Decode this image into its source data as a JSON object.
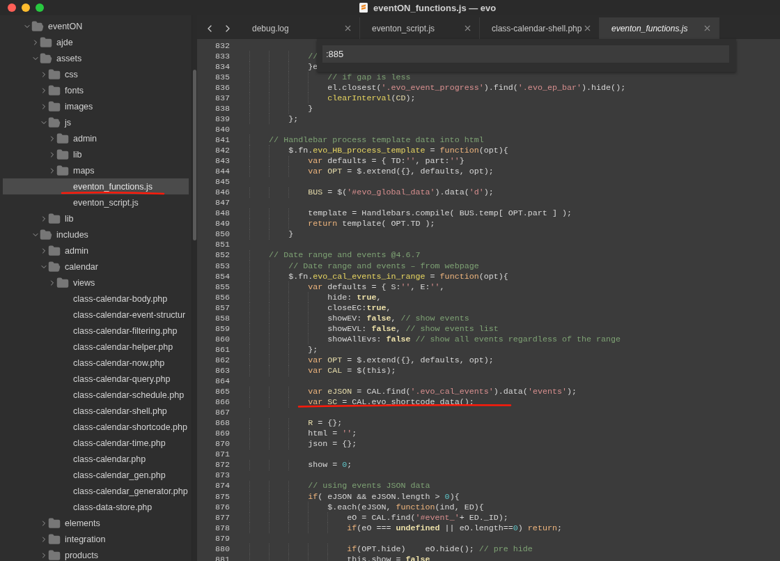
{
  "window": {
    "title": "eventON_functions.js — evo"
  },
  "sidebar": {
    "tree": [
      {
        "label": "eventON",
        "kind": "folder",
        "expanded": true,
        "selected": false,
        "children": [
          {
            "label": "ajde",
            "kind": "folder",
            "expanded": false,
            "selected": false
          },
          {
            "label": "assets",
            "kind": "folder",
            "expanded": true,
            "selected": false,
            "children": [
              {
                "label": "css",
                "kind": "folder",
                "expanded": false,
                "selected": false
              },
              {
                "label": "fonts",
                "kind": "folder",
                "expanded": false,
                "selected": false
              },
              {
                "label": "images",
                "kind": "folder",
                "expanded": false,
                "selected": false
              },
              {
                "label": "js",
                "kind": "folder",
                "expanded": true,
                "selected": false,
                "children": [
                  {
                    "label": "admin",
                    "kind": "folder",
                    "expanded": false,
                    "selected": false
                  },
                  {
                    "label": "lib",
                    "kind": "folder",
                    "expanded": false,
                    "selected": false
                  },
                  {
                    "label": "maps",
                    "kind": "folder",
                    "expanded": false,
                    "selected": false
                  },
                  {
                    "label": "eventon_functions.js",
                    "kind": "file",
                    "selected": true,
                    "underlined": true
                  },
                  {
                    "label": "eventon_script.js",
                    "kind": "file",
                    "selected": false
                  }
                ]
              },
              {
                "label": "lib",
                "kind": "folder",
                "expanded": false,
                "selected": false
              }
            ]
          },
          {
            "label": "includes",
            "kind": "folder",
            "expanded": true,
            "selected": false,
            "children": [
              {
                "label": "admin",
                "kind": "folder",
                "expanded": false,
                "selected": false
              },
              {
                "label": "calendar",
                "kind": "folder",
                "expanded": true,
                "selected": false,
                "children": [
                  {
                    "label": "views",
                    "kind": "folder",
                    "expanded": false,
                    "selected": false
                  },
                  {
                    "label": "class-calendar-body.php",
                    "kind": "file",
                    "selected": false
                  },
                  {
                    "label": "class-calendar-event-structur",
                    "kind": "file",
                    "selected": false
                  },
                  {
                    "label": "class-calendar-filtering.php",
                    "kind": "file",
                    "selected": false
                  },
                  {
                    "label": "class-calendar-helper.php",
                    "kind": "file",
                    "selected": false
                  },
                  {
                    "label": "class-calendar-now.php",
                    "kind": "file",
                    "selected": false
                  },
                  {
                    "label": "class-calendar-query.php",
                    "kind": "file",
                    "selected": false
                  },
                  {
                    "label": "class-calendar-schedule.php",
                    "kind": "file",
                    "selected": false
                  },
                  {
                    "label": "class-calendar-shell.php",
                    "kind": "file",
                    "selected": false
                  },
                  {
                    "label": "class-calendar-shortcode.php",
                    "kind": "file",
                    "selected": false
                  },
                  {
                    "label": "class-calendar-time.php",
                    "kind": "file",
                    "selected": false
                  },
                  {
                    "label": "class-calendar.php",
                    "kind": "file",
                    "selected": false
                  },
                  {
                    "label": "class-calendar_gen.php",
                    "kind": "file",
                    "selected": false
                  },
                  {
                    "label": "class-calendar_generator.php",
                    "kind": "file",
                    "selected": false
                  },
                  {
                    "label": "class-data-store.php",
                    "kind": "file",
                    "selected": false
                  }
                ]
              },
              {
                "label": "elements",
                "kind": "folder",
                "expanded": false,
                "selected": false
              },
              {
                "label": "integration",
                "kind": "folder",
                "expanded": false,
                "selected": false
              },
              {
                "label": "products",
                "kind": "folder",
                "expanded": false,
                "selected": false
              }
            ]
          }
        ]
      }
    ]
  },
  "tabs": [
    {
      "label": "debug.log",
      "selected": false
    },
    {
      "label": "eventon_script.js",
      "selected": false
    },
    {
      "label": "class-calendar-shell.php",
      "selected": false
    },
    {
      "label": "eventon_functions.js",
      "selected": true
    }
  ],
  "goto": {
    "value": ":885"
  },
  "editor": {
    "lines": [
      {
        "number": "832"
      },
      {
        "number": "833",
        "tokens": [
          {
            "kind": "comment",
            "text": "                //"
          }
        ]
      },
      {
        "number": "834",
        "tokens": [
          {
            "kind": "plain",
            "text": "                }e"
          }
        ]
      },
      {
        "number": "835",
        "tokens": [
          {
            "kind": "comment",
            "text": "                    // if gap is less"
          }
        ]
      },
      {
        "number": "836",
        "tokens": [
          {
            "kind": "plain",
            "text": "                    el.closest("
          },
          {
            "kind": "string",
            "text": "'.evo_event_progress'"
          },
          {
            "kind": "plain",
            "text": ").find("
          },
          {
            "kind": "string",
            "text": "'.evo_ep_bar'"
          },
          {
            "kind": "plain",
            "text": ").hide();"
          }
        ]
      },
      {
        "number": "837",
        "tokens": [
          {
            "kind": "function",
            "text": "                    clearInterval"
          },
          {
            "kind": "plain",
            "text": "("
          },
          {
            "kind": "variable",
            "text": "CD"
          },
          {
            "kind": "plain",
            "text": ");"
          }
        ]
      },
      {
        "number": "838",
        "tokens": [
          {
            "kind": "plain",
            "text": "                }"
          }
        ]
      },
      {
        "number": "839",
        "tokens": [
          {
            "kind": "plain",
            "text": "            };"
          }
        ]
      },
      {
        "number": "840"
      },
      {
        "number": "841",
        "tokens": [
          {
            "kind": "comment",
            "text": "        // Handlebar process template data into html"
          }
        ]
      },
      {
        "number": "842",
        "tokens": [
          {
            "kind": "plain",
            "text": "            $.fn."
          },
          {
            "kind": "function",
            "text": "evo_HB_process_template"
          },
          {
            "kind": "plain",
            "text": " = "
          },
          {
            "kind": "keyword",
            "text": "function"
          },
          {
            "kind": "plain",
            "text": "(opt){"
          }
        ]
      },
      {
        "number": "843",
        "tokens": [
          {
            "kind": "keyword",
            "text": "                var"
          },
          {
            "kind": "plain",
            "text": " defaults = { TD:"
          },
          {
            "kind": "string",
            "text": "''"
          },
          {
            "kind": "plain",
            "text": ", part:"
          },
          {
            "kind": "string",
            "text": "''"
          },
          {
            "kind": "plain",
            "text": "}"
          }
        ]
      },
      {
        "number": "844",
        "tokens": [
          {
            "kind": "keyword",
            "text": "                var"
          },
          {
            "kind": "variable",
            "text": " OPT"
          },
          {
            "kind": "plain",
            "text": " = $.extend({}, defaults, opt);"
          }
        ]
      },
      {
        "number": "845"
      },
      {
        "number": "846",
        "tokens": [
          {
            "kind": "variable",
            "text": "                BUS"
          },
          {
            "kind": "plain",
            "text": " = $("
          },
          {
            "kind": "string",
            "text": "'#evo_global_data'"
          },
          {
            "kind": "plain",
            "text": ").data("
          },
          {
            "kind": "string",
            "text": "'d'"
          },
          {
            "kind": "plain",
            "text": ");"
          }
        ]
      },
      {
        "number": "847"
      },
      {
        "number": "848",
        "tokens": [
          {
            "kind": "plain",
            "text": "                template = Handlebars.compile( BUS.temp[ OPT.part ] );"
          }
        ]
      },
      {
        "number": "849",
        "tokens": [
          {
            "kind": "keyword",
            "text": "                return"
          },
          {
            "kind": "plain",
            "text": " template( OPT.TD );"
          }
        ]
      },
      {
        "number": "850",
        "tokens": [
          {
            "kind": "plain",
            "text": "            }"
          }
        ]
      },
      {
        "number": "851"
      },
      {
        "number": "852",
        "tokens": [
          {
            "kind": "comment",
            "text": "        // Date range and events @4.6.7"
          }
        ]
      },
      {
        "number": "853",
        "tokens": [
          {
            "kind": "comment",
            "text": "            // Date range and events – from webpage"
          }
        ]
      },
      {
        "number": "854",
        "tokens": [
          {
            "kind": "plain",
            "text": "            $.fn."
          },
          {
            "kind": "function",
            "text": "evo_cal_events_in_range"
          },
          {
            "kind": "plain",
            "text": " = "
          },
          {
            "kind": "keyword",
            "text": "function"
          },
          {
            "kind": "plain",
            "text": "(opt){"
          }
        ]
      },
      {
        "number": "855",
        "tokens": [
          {
            "kind": "keyword",
            "text": "                var"
          },
          {
            "kind": "plain",
            "text": " defaults = { S:"
          },
          {
            "kind": "string",
            "text": "''"
          },
          {
            "kind": "plain",
            "text": ", E:"
          },
          {
            "kind": "string",
            "text": "''"
          },
          {
            "kind": "plain",
            "text": ","
          }
        ]
      },
      {
        "number": "856",
        "tokens": [
          {
            "kind": "plain",
            "text": "                    hide: "
          },
          {
            "kind": "constant",
            "text": "true"
          },
          {
            "kind": "plain",
            "text": ","
          }
        ]
      },
      {
        "number": "857",
        "tokens": [
          {
            "kind": "plain",
            "text": "                    closeEC:"
          },
          {
            "kind": "constant",
            "text": "true"
          },
          {
            "kind": "plain",
            "text": ","
          }
        ]
      },
      {
        "number": "858",
        "tokens": [
          {
            "kind": "plain",
            "text": "                    showEV: "
          },
          {
            "kind": "constant",
            "text": "false"
          },
          {
            "kind": "plain",
            "text": ","
          },
          {
            "kind": "comment",
            "text": " // show events"
          }
        ]
      },
      {
        "number": "859",
        "tokens": [
          {
            "kind": "plain",
            "text": "                    showEVL: "
          },
          {
            "kind": "constant",
            "text": "false"
          },
          {
            "kind": "plain",
            "text": ","
          },
          {
            "kind": "comment",
            "text": " // show events list"
          }
        ]
      },
      {
        "number": "860",
        "tokens": [
          {
            "kind": "plain",
            "text": "                    showAllEvs: "
          },
          {
            "kind": "constant",
            "text": "false"
          },
          {
            "kind": "comment",
            "text": " // show all events regardless of the range"
          }
        ]
      },
      {
        "number": "861",
        "tokens": [
          {
            "kind": "plain",
            "text": "                };"
          }
        ]
      },
      {
        "number": "862",
        "tokens": [
          {
            "kind": "keyword",
            "text": "                var"
          },
          {
            "kind": "variable",
            "text": " OPT"
          },
          {
            "kind": "plain",
            "text": " = $.extend({}, defaults, opt);"
          }
        ]
      },
      {
        "number": "863",
        "tokens": [
          {
            "kind": "keyword",
            "text": "                var"
          },
          {
            "kind": "variable",
            "text": " CAL"
          },
          {
            "kind": "plain",
            "text": " = $(this);"
          }
        ]
      },
      {
        "number": "864"
      },
      {
        "number": "865",
        "tokens": [
          {
            "kind": "keyword",
            "text": "                var"
          },
          {
            "kind": "variable",
            "text": " eJSON"
          },
          {
            "kind": "plain",
            "text": " = CAL.find("
          },
          {
            "kind": "string",
            "text": "'.evo_cal_events'"
          },
          {
            "kind": "plain",
            "text": ").data("
          },
          {
            "kind": "string",
            "text": "'events'"
          },
          {
            "kind": "plain",
            "text": ");"
          }
        ]
      },
      {
        "number": "866",
        "underlined": true,
        "tokens": [
          {
            "kind": "keyword",
            "text": "                var"
          },
          {
            "kind": "variable",
            "text": " SC"
          },
          {
            "kind": "plain",
            "text": " = CAL.evo_shortcode_data();"
          }
        ]
      },
      {
        "number": "867"
      },
      {
        "number": "868",
        "tokens": [
          {
            "kind": "variable",
            "text": "                R"
          },
          {
            "kind": "plain",
            "text": " = {};"
          }
        ]
      },
      {
        "number": "869",
        "tokens": [
          {
            "kind": "plain",
            "text": "                html = "
          },
          {
            "kind": "string",
            "text": "''"
          },
          {
            "kind": "plain",
            "text": ";"
          }
        ]
      },
      {
        "number": "870",
        "tokens": [
          {
            "kind": "plain",
            "text": "                json = {};"
          }
        ]
      },
      {
        "number": "871"
      },
      {
        "number": "872",
        "tokens": [
          {
            "kind": "plain",
            "text": "                show = "
          },
          {
            "kind": "number",
            "text": "0"
          },
          {
            "kind": "plain",
            "text": ";"
          }
        ]
      },
      {
        "number": "873"
      },
      {
        "number": "874",
        "tokens": [
          {
            "kind": "comment",
            "text": "                // using events JSON data"
          }
        ]
      },
      {
        "number": "875",
        "tokens": [
          {
            "kind": "keyword",
            "text": "                if"
          },
          {
            "kind": "plain",
            "text": "( eJSON && eJSON.length > "
          },
          {
            "kind": "number",
            "text": "0"
          },
          {
            "kind": "plain",
            "text": "){"
          }
        ]
      },
      {
        "number": "876",
        "tokens": [
          {
            "kind": "plain",
            "text": "                    $.each(eJSON, "
          },
          {
            "kind": "keyword",
            "text": "function"
          },
          {
            "kind": "plain",
            "text": "(ind, ED){"
          }
        ]
      },
      {
        "number": "877",
        "tokens": [
          {
            "kind": "plain",
            "text": "                        eO = CAL.find("
          },
          {
            "kind": "string",
            "text": "'#event_'"
          },
          {
            "kind": "plain",
            "text": "+ ED._ID);"
          }
        ]
      },
      {
        "number": "878",
        "tokens": [
          {
            "kind": "keyword",
            "text": "                        if"
          },
          {
            "kind": "plain",
            "text": "(eO === "
          },
          {
            "kind": "constant",
            "text": "undefined"
          },
          {
            "kind": "plain",
            "text": " || eO.length=="
          },
          {
            "kind": "number",
            "text": "0"
          },
          {
            "kind": "plain",
            "text": ")"
          },
          {
            "kind": "keyword",
            "text": " return"
          },
          {
            "kind": "plain",
            "text": ";"
          }
        ]
      },
      {
        "number": "879"
      },
      {
        "number": "880",
        "tokens": [
          {
            "kind": "keyword",
            "text": "                        if"
          },
          {
            "kind": "plain",
            "text": "(OPT.hide)    eO.hide();"
          },
          {
            "kind": "comment",
            "text": " // pre hide"
          }
        ]
      },
      {
        "number": "881",
        "tokens": [
          {
            "kind": "plain",
            "text": "                        this.show = "
          },
          {
            "kind": "constant",
            "text": "false"
          }
        ]
      }
    ]
  }
}
